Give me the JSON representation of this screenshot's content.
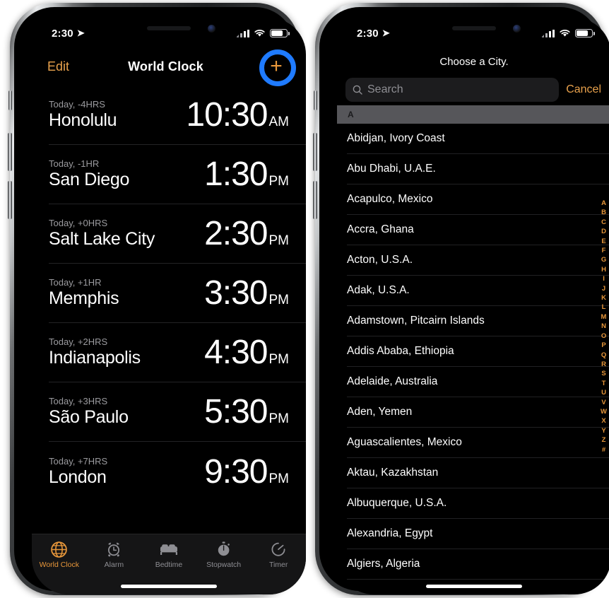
{
  "colors": {
    "accent_orange": "#e8973a",
    "tint_orange": "#e8a14c",
    "highlight_blue": "#1f7bff",
    "screen_bg": "#000000",
    "section_header_bg": "#56565a"
  },
  "left_phone": {
    "status_bar": {
      "time": "2:30",
      "location_icon": "location-arrow-icon",
      "signal_icon": "cellular-signal-icon",
      "wifi_icon": "wifi-icon",
      "battery_icon": "battery-icon"
    },
    "nav": {
      "edit_label": "Edit",
      "title": "World Clock",
      "add_icon": "plus-icon",
      "highlight": "blue-circle-highlight"
    },
    "clocks": [
      {
        "offset": "Today, -4HRS",
        "city": "Honolulu",
        "time": "10:30",
        "ampm": "AM"
      },
      {
        "offset": "Today, -1HR",
        "city": "San Diego",
        "time": "1:30",
        "ampm": "PM"
      },
      {
        "offset": "Today, +0HRS",
        "city": "Salt Lake City",
        "time": "2:30",
        "ampm": "PM"
      },
      {
        "offset": "Today, +1HR",
        "city": "Memphis",
        "time": "3:30",
        "ampm": "PM"
      },
      {
        "offset": "Today, +2HRS",
        "city": "Indianapolis",
        "time": "4:30",
        "ampm": "PM"
      },
      {
        "offset": "Today, +3HRS",
        "city": "São Paulo",
        "time": "5:30",
        "ampm": "PM"
      },
      {
        "offset": "Today, +7HRS",
        "city": "London",
        "time": "9:30",
        "ampm": "PM"
      }
    ],
    "tabs": [
      {
        "label": "World Clock",
        "icon": "globe-icon",
        "active": true
      },
      {
        "label": "Alarm",
        "icon": "alarm-clock-icon",
        "active": false
      },
      {
        "label": "Bedtime",
        "icon": "bed-icon",
        "active": false
      },
      {
        "label": "Stopwatch",
        "icon": "stopwatch-icon",
        "active": false
      },
      {
        "label": "Timer",
        "icon": "timer-icon",
        "active": false
      }
    ]
  },
  "right_phone": {
    "status_bar": {
      "time": "2:30",
      "location_icon": "location-arrow-icon",
      "signal_icon": "cellular-signal-icon",
      "wifi_icon": "wifi-icon",
      "battery_icon": "battery-icon"
    },
    "title": "Choose a City.",
    "search": {
      "placeholder": "Search",
      "value": "",
      "icon": "search-icon",
      "cancel_label": "Cancel"
    },
    "section_header": "A",
    "cities": [
      "Abidjan, Ivory Coast",
      "Abu Dhabi, U.A.E.",
      "Acapulco, Mexico",
      "Accra, Ghana",
      "Acton, U.S.A.",
      "Adak, U.S.A.",
      "Adamstown, Pitcairn Islands",
      "Addis Ababa, Ethiopia",
      "Adelaide, Australia",
      "Aden, Yemen",
      "Aguascalientes, Mexico",
      "Aktau, Kazakhstan",
      "Albuquerque, U.S.A.",
      "Alexandria, Egypt",
      "Algiers, Algeria"
    ],
    "index_letters": [
      "A",
      "B",
      "C",
      "D",
      "E",
      "F",
      "G",
      "H",
      "I",
      "J",
      "K",
      "L",
      "M",
      "N",
      "O",
      "P",
      "Q",
      "R",
      "S",
      "T",
      "U",
      "V",
      "W",
      "X",
      "Y",
      "Z",
      "#"
    ]
  }
}
